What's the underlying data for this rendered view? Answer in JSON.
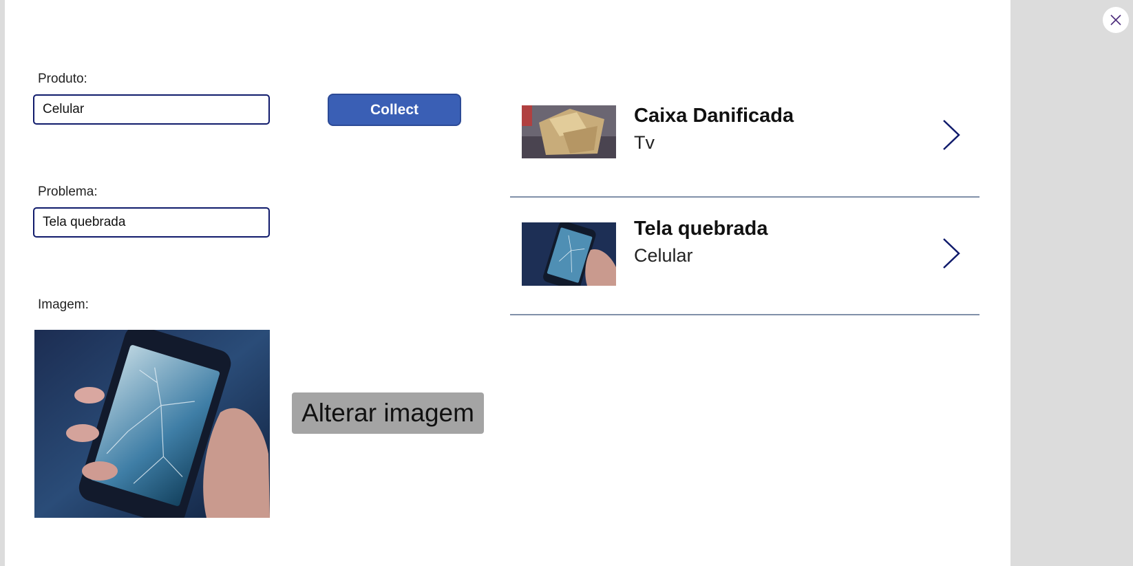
{
  "form": {
    "produto_label": "Produto:",
    "produto_value": "Celular",
    "problema_label": "Problema:",
    "problema_value": "Tela quebrada",
    "imagem_label": "Imagem:",
    "collect_label": "Collect",
    "alterar_label": "Alterar imagem"
  },
  "gallery": {
    "items": [
      {
        "title": "Caixa Danificada",
        "subtitle": "Tv",
        "thumb_icon": "damaged-box-photo"
      },
      {
        "title": "Tela quebrada",
        "subtitle": "Celular",
        "thumb_icon": "broken-phone-photo"
      }
    ]
  },
  "colors": {
    "accent": "#3a5fb5",
    "field_border": "#0f1a6b",
    "chevron": "#0f1a6b",
    "side_panel": "#dcdcdc"
  }
}
